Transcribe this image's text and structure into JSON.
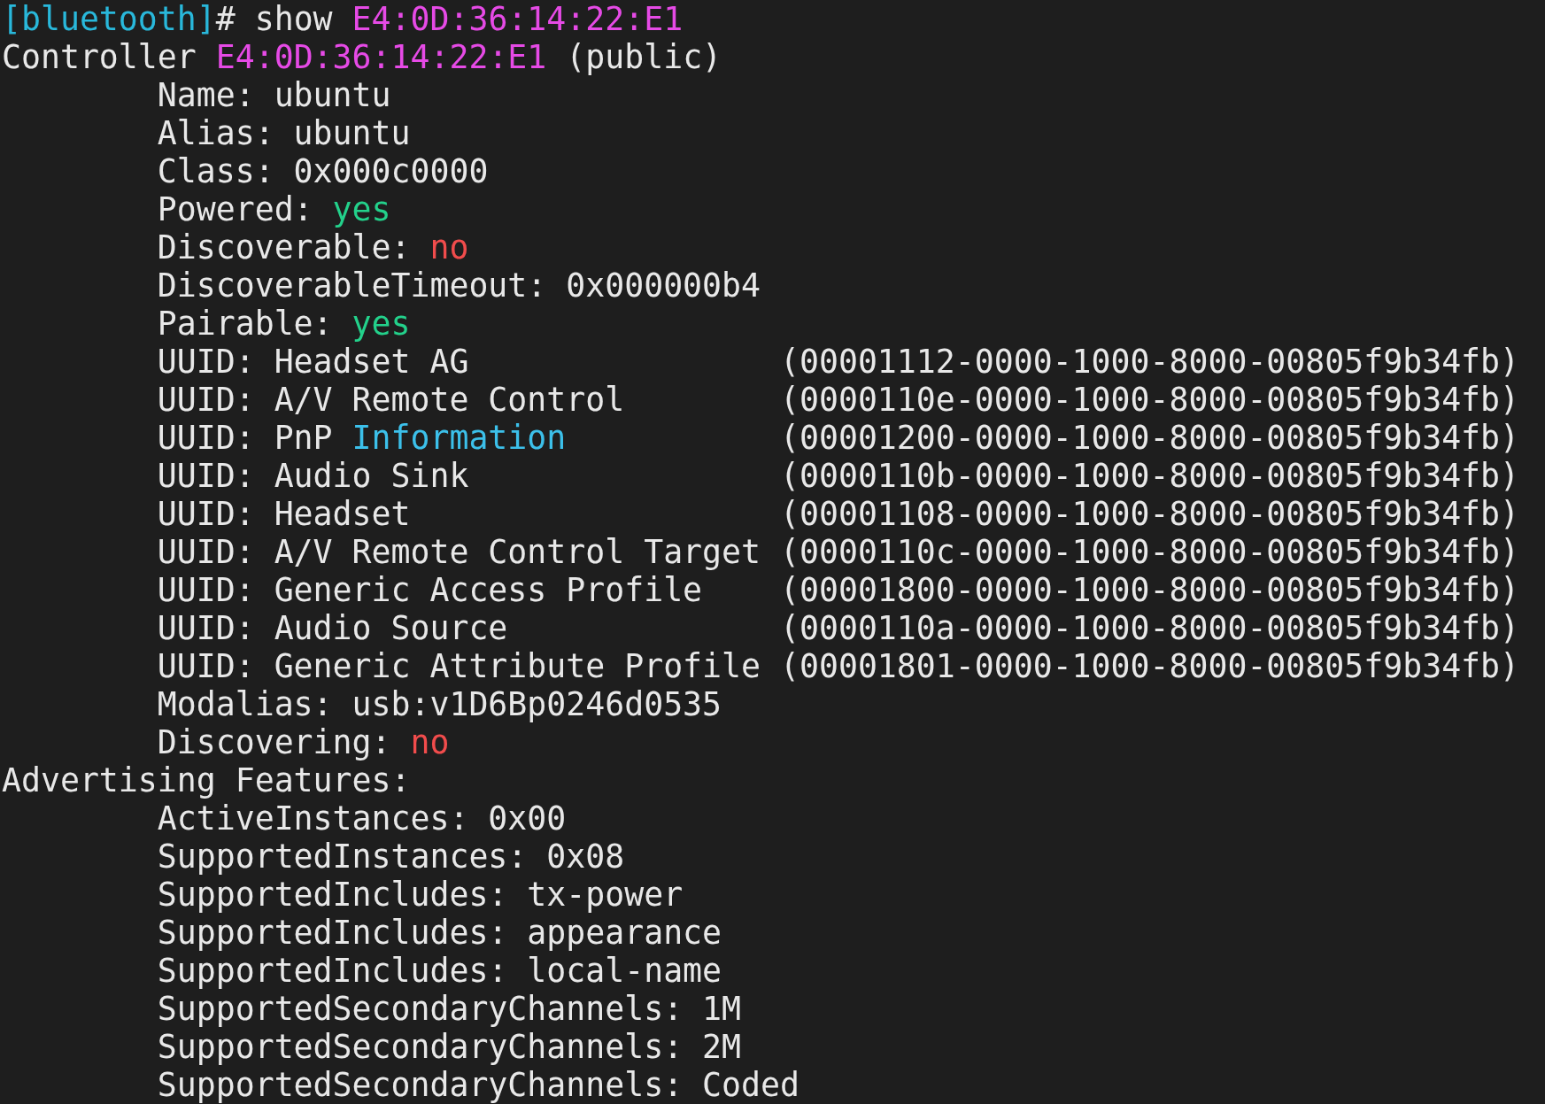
{
  "terminal": {
    "lines": [
      {
        "segments": [
          {
            "text": "[bluetooth]",
            "color": "#29b8db"
          },
          {
            "text": "# show "
          },
          {
            "text": "E4:0D:36:14:22:E1",
            "color": "#e64ae6"
          }
        ]
      },
      {
        "segments": [
          {
            "text": "Controller "
          },
          {
            "text": "E4:0D:36:14:22:E1",
            "color": "#e64ae6"
          },
          {
            "text": " (public)"
          }
        ],
        "children": [
          {
            "segments": [
              {
                "text": "Name: ubuntu"
              }
            ]
          },
          {
            "segments": [
              {
                "text": "Alias: ubuntu"
              }
            ]
          },
          {
            "segments": [
              {
                "text": "Class: 0x000c0000"
              }
            ]
          },
          {
            "segments": [
              {
                "text": "Powered: "
              },
              {
                "text": "yes",
                "color": "#23d18b"
              }
            ]
          },
          {
            "segments": [
              {
                "text": "Discoverable: "
              },
              {
                "text": "no",
                "color": "#f14c4c"
              }
            ]
          },
          {
            "segments": [
              {
                "text": "DiscoverableTimeout: 0x000000b4"
              }
            ]
          },
          {
            "segments": [
              {
                "text": "Pairable: "
              },
              {
                "text": "yes",
                "color": "#23d18b"
              }
            ]
          },
          {
            "segments": [
              {
                "text": "UUID: Headset AG"
              }
            ],
            "uuid": "(00001112-0000-1000-8000-00805f9b34fb)"
          },
          {
            "segments": [
              {
                "text": "UUID: A/V Remote Control"
              }
            ],
            "uuid": "(0000110e-0000-1000-8000-00805f9b34fb)"
          },
          {
            "segments": [
              {
                "text": "UUID: PnP "
              },
              {
                "text": "Information",
                "color": "#3cc0ea"
              }
            ],
            "uuid": "(00001200-0000-1000-8000-00805f9b34fb)"
          },
          {
            "segments": [
              {
                "text": "UUID: Audio Sink"
              }
            ],
            "uuid": "(0000110b-0000-1000-8000-00805f9b34fb)"
          },
          {
            "segments": [
              {
                "text": "UUID: Headset"
              }
            ],
            "uuid": "(00001108-0000-1000-8000-00805f9b34fb)"
          },
          {
            "segments": [
              {
                "text": "UUID: A/V Remote Control Target"
              }
            ],
            "uuid": "(0000110c-0000-1000-8000-00805f9b34fb)"
          },
          {
            "segments": [
              {
                "text": "UUID: Generic Access Profile"
              }
            ],
            "uuid": "(00001800-0000-1000-8000-00805f9b34fb)"
          },
          {
            "segments": [
              {
                "text": "UUID: Audio Source"
              }
            ],
            "uuid": "(0000110a-0000-1000-8000-00805f9b34fb)"
          },
          {
            "segments": [
              {
                "text": "UUID: Generic Attribute Profile"
              }
            ],
            "uuid": "(00001801-0000-1000-8000-00805f9b34fb)"
          },
          {
            "segments": [
              {
                "text": "Modalias: usb:v1D6Bp0246d0535"
              }
            ]
          },
          {
            "segments": [
              {
                "text": "Discovering: "
              },
              {
                "text": "no",
                "color": "#f14c4c"
              }
            ]
          }
        ]
      },
      {
        "segments": [
          {
            "text": "Advertising Features:"
          }
        ],
        "children": [
          {
            "segments": [
              {
                "text": "ActiveInstances: 0x00"
              }
            ]
          },
          {
            "segments": [
              {
                "text": "SupportedInstances: 0x08"
              }
            ]
          },
          {
            "segments": [
              {
                "text": "SupportedIncludes: tx-power"
              }
            ]
          },
          {
            "segments": [
              {
                "text": "SupportedIncludes: appearance"
              }
            ]
          },
          {
            "segments": [
              {
                "text": "SupportedIncludes: local-name"
              }
            ]
          },
          {
            "segments": [
              {
                "text": "SupportedSecondaryChannels: 1M"
              }
            ]
          },
          {
            "segments": [
              {
                "text": "SupportedSecondaryChannels: 2M"
              }
            ]
          },
          {
            "segments": [
              {
                "text": "SupportedSecondaryChannels: Coded"
              }
            ]
          }
        ]
      }
    ]
  }
}
